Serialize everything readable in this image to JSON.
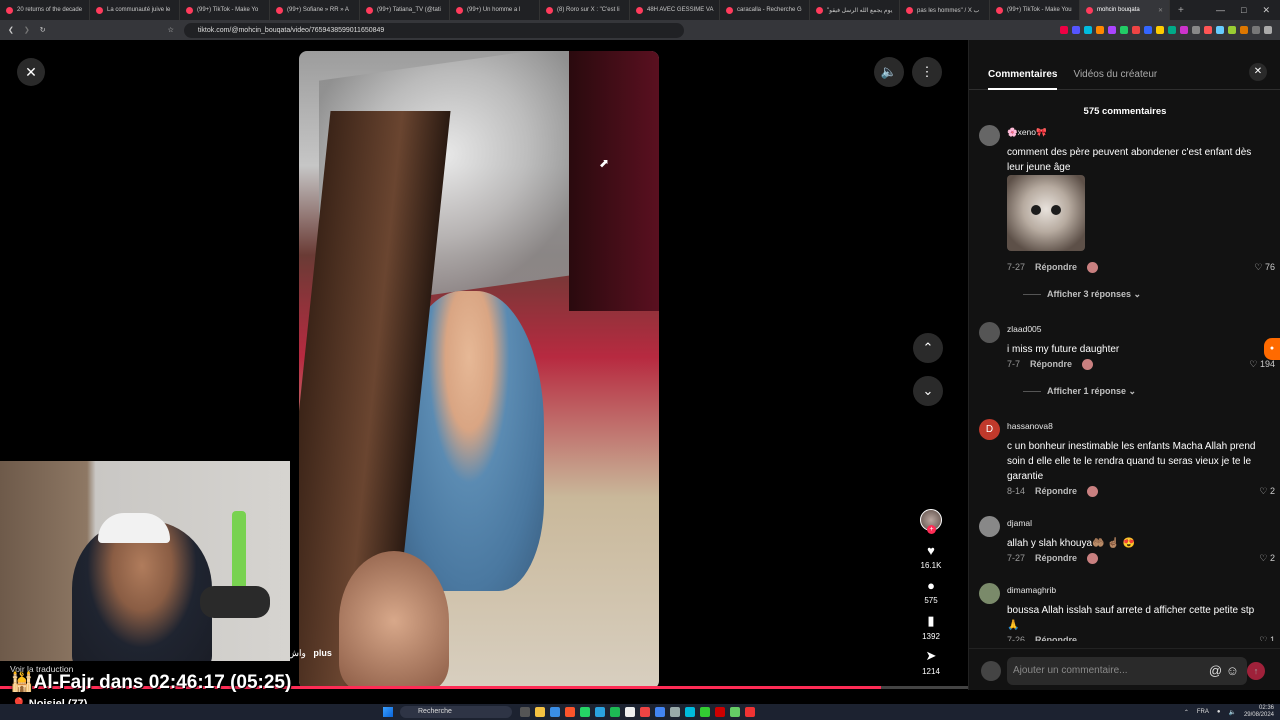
{
  "browser": {
    "tabs": [
      {
        "title": "20 returns of the decade"
      },
      {
        "title": "La communauté juive le"
      },
      {
        "title": "(99+) TikTok - Make Yo"
      },
      {
        "title": "(99+) Sofiane » RR » A"
      },
      {
        "title": "(99+) Tatiana_TV (@tati"
      },
      {
        "title": "(99+) Un homme a l"
      },
      {
        "title": "(8) Roro sur X : \"C'est li"
      },
      {
        "title": "48H AVEC GESSIME VA"
      },
      {
        "title": "caracalla - Recherche G"
      },
      {
        "title": "\"يوم يجمع الله الرسل فيقو"
      },
      {
        "title": "pas les hommes\" / X ب"
      },
      {
        "title": "(99+) TikTok - Make You"
      },
      {
        "title": "mohcin bouqata",
        "active": true
      }
    ],
    "new_tab": "+",
    "url": "tiktok.com/@mohcin_bouqata/video/7659438599011650849"
  },
  "video": {
    "caption_text": "واش",
    "caption_more": "plus",
    "progress": 0.91
  },
  "sidebar_actions": {
    "likes": "16.1K",
    "comments": "575",
    "saves": "1392",
    "shares": "1214"
  },
  "panel": {
    "tab_comments": "Commentaires",
    "tab_videos": "Vidéos du créateur",
    "count": "575 commentaires",
    "reply_label": "Répondre",
    "input_placeholder": "Ajouter un commentaire...",
    "comments": [
      {
        "user": "🌸xeno🎀",
        "text": "comment des père peuvent abondener c'est enfant dès leur jeune âge",
        "date": "7-27",
        "likes": "76",
        "replies": "Afficher 3 réponses",
        "avatar_color": "#666"
      },
      {
        "user": "zlaad005",
        "text": "i miss my future daughter",
        "date": "7-7",
        "likes": "194",
        "replies": "Afficher 1 réponse",
        "avatar_color": "#555"
      },
      {
        "user": "hassanova8",
        "text": "c un bonheur inestimable les enfants Macha Allah prend soin d elle elle te le rendra quand tu seras vieux je te le garantie",
        "date": "8-14",
        "likes": "2",
        "avatar_letter": "D",
        "avatar_color": "#c0392b"
      },
      {
        "user": "djamal",
        "text": "allah y slah khouya🤲🏽 ☝🏽 😍",
        "date": "7-27",
        "likes": "2",
        "avatar_color": "#888"
      },
      {
        "user": "dimamaghrib",
        "text": "boussa Allah isslah sauf arrete d afficher cette petite stp🙏",
        "date": "7-26",
        "likes": "1",
        "avatar_color": "#7a8a6a"
      }
    ]
  },
  "stream": {
    "translate": "Voir la traduction",
    "overlay": "🕌Al-Fajr dans 02:46:17 (05:25)",
    "viewer": "🎈 Noisiel (77)"
  },
  "taskbar": {
    "search": "Recherche",
    "lang": "FRA",
    "time": "02:36",
    "date": "29/08/2024"
  }
}
